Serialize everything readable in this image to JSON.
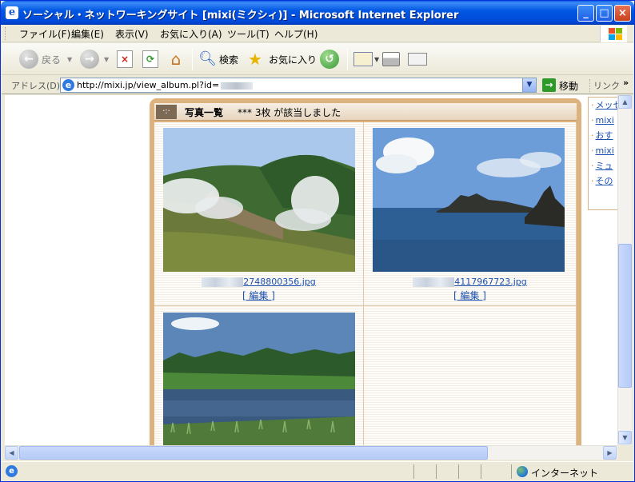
{
  "window": {
    "title": "ソーシャル・ネットワーキングサイト [mixi(ミクシィ)] - Microsoft Internet Explorer"
  },
  "menu": {
    "items": [
      "ファイル(F)",
      "編集(E)",
      "表示(V)",
      "お気に入り(A)",
      "ツール(T)",
      "ヘルプ(H)"
    ]
  },
  "toolbar": {
    "back_label": "戻る",
    "search_label": "検索",
    "favorites_label": "お気に入り"
  },
  "address": {
    "label": "アドレス(D)",
    "url": "http://mixi.jp/view_album.pl?id=",
    "go_label": "移動",
    "links_label": "リンク"
  },
  "album": {
    "header_title": "写真一覧",
    "header_count": "*** 3枚 が該当しました",
    "photos": [
      {
        "filename": "2748800356.jpg",
        "edit": "[ 編集 ]"
      },
      {
        "filename": "4117967723.jpg",
        "edit": "[ 編集 ]"
      },
      {
        "filename": "",
        "edit": ""
      }
    ]
  },
  "sidebar_links": [
    "メッセ",
    "mixi",
    "おす",
    "mixi",
    "ミュ",
    "その"
  ],
  "statusbar": {
    "zone": "インターネット"
  },
  "colors": {
    "album_frame": "#dcb27e",
    "link": "#1a4fb0",
    "titlebar": "#0358e3"
  }
}
